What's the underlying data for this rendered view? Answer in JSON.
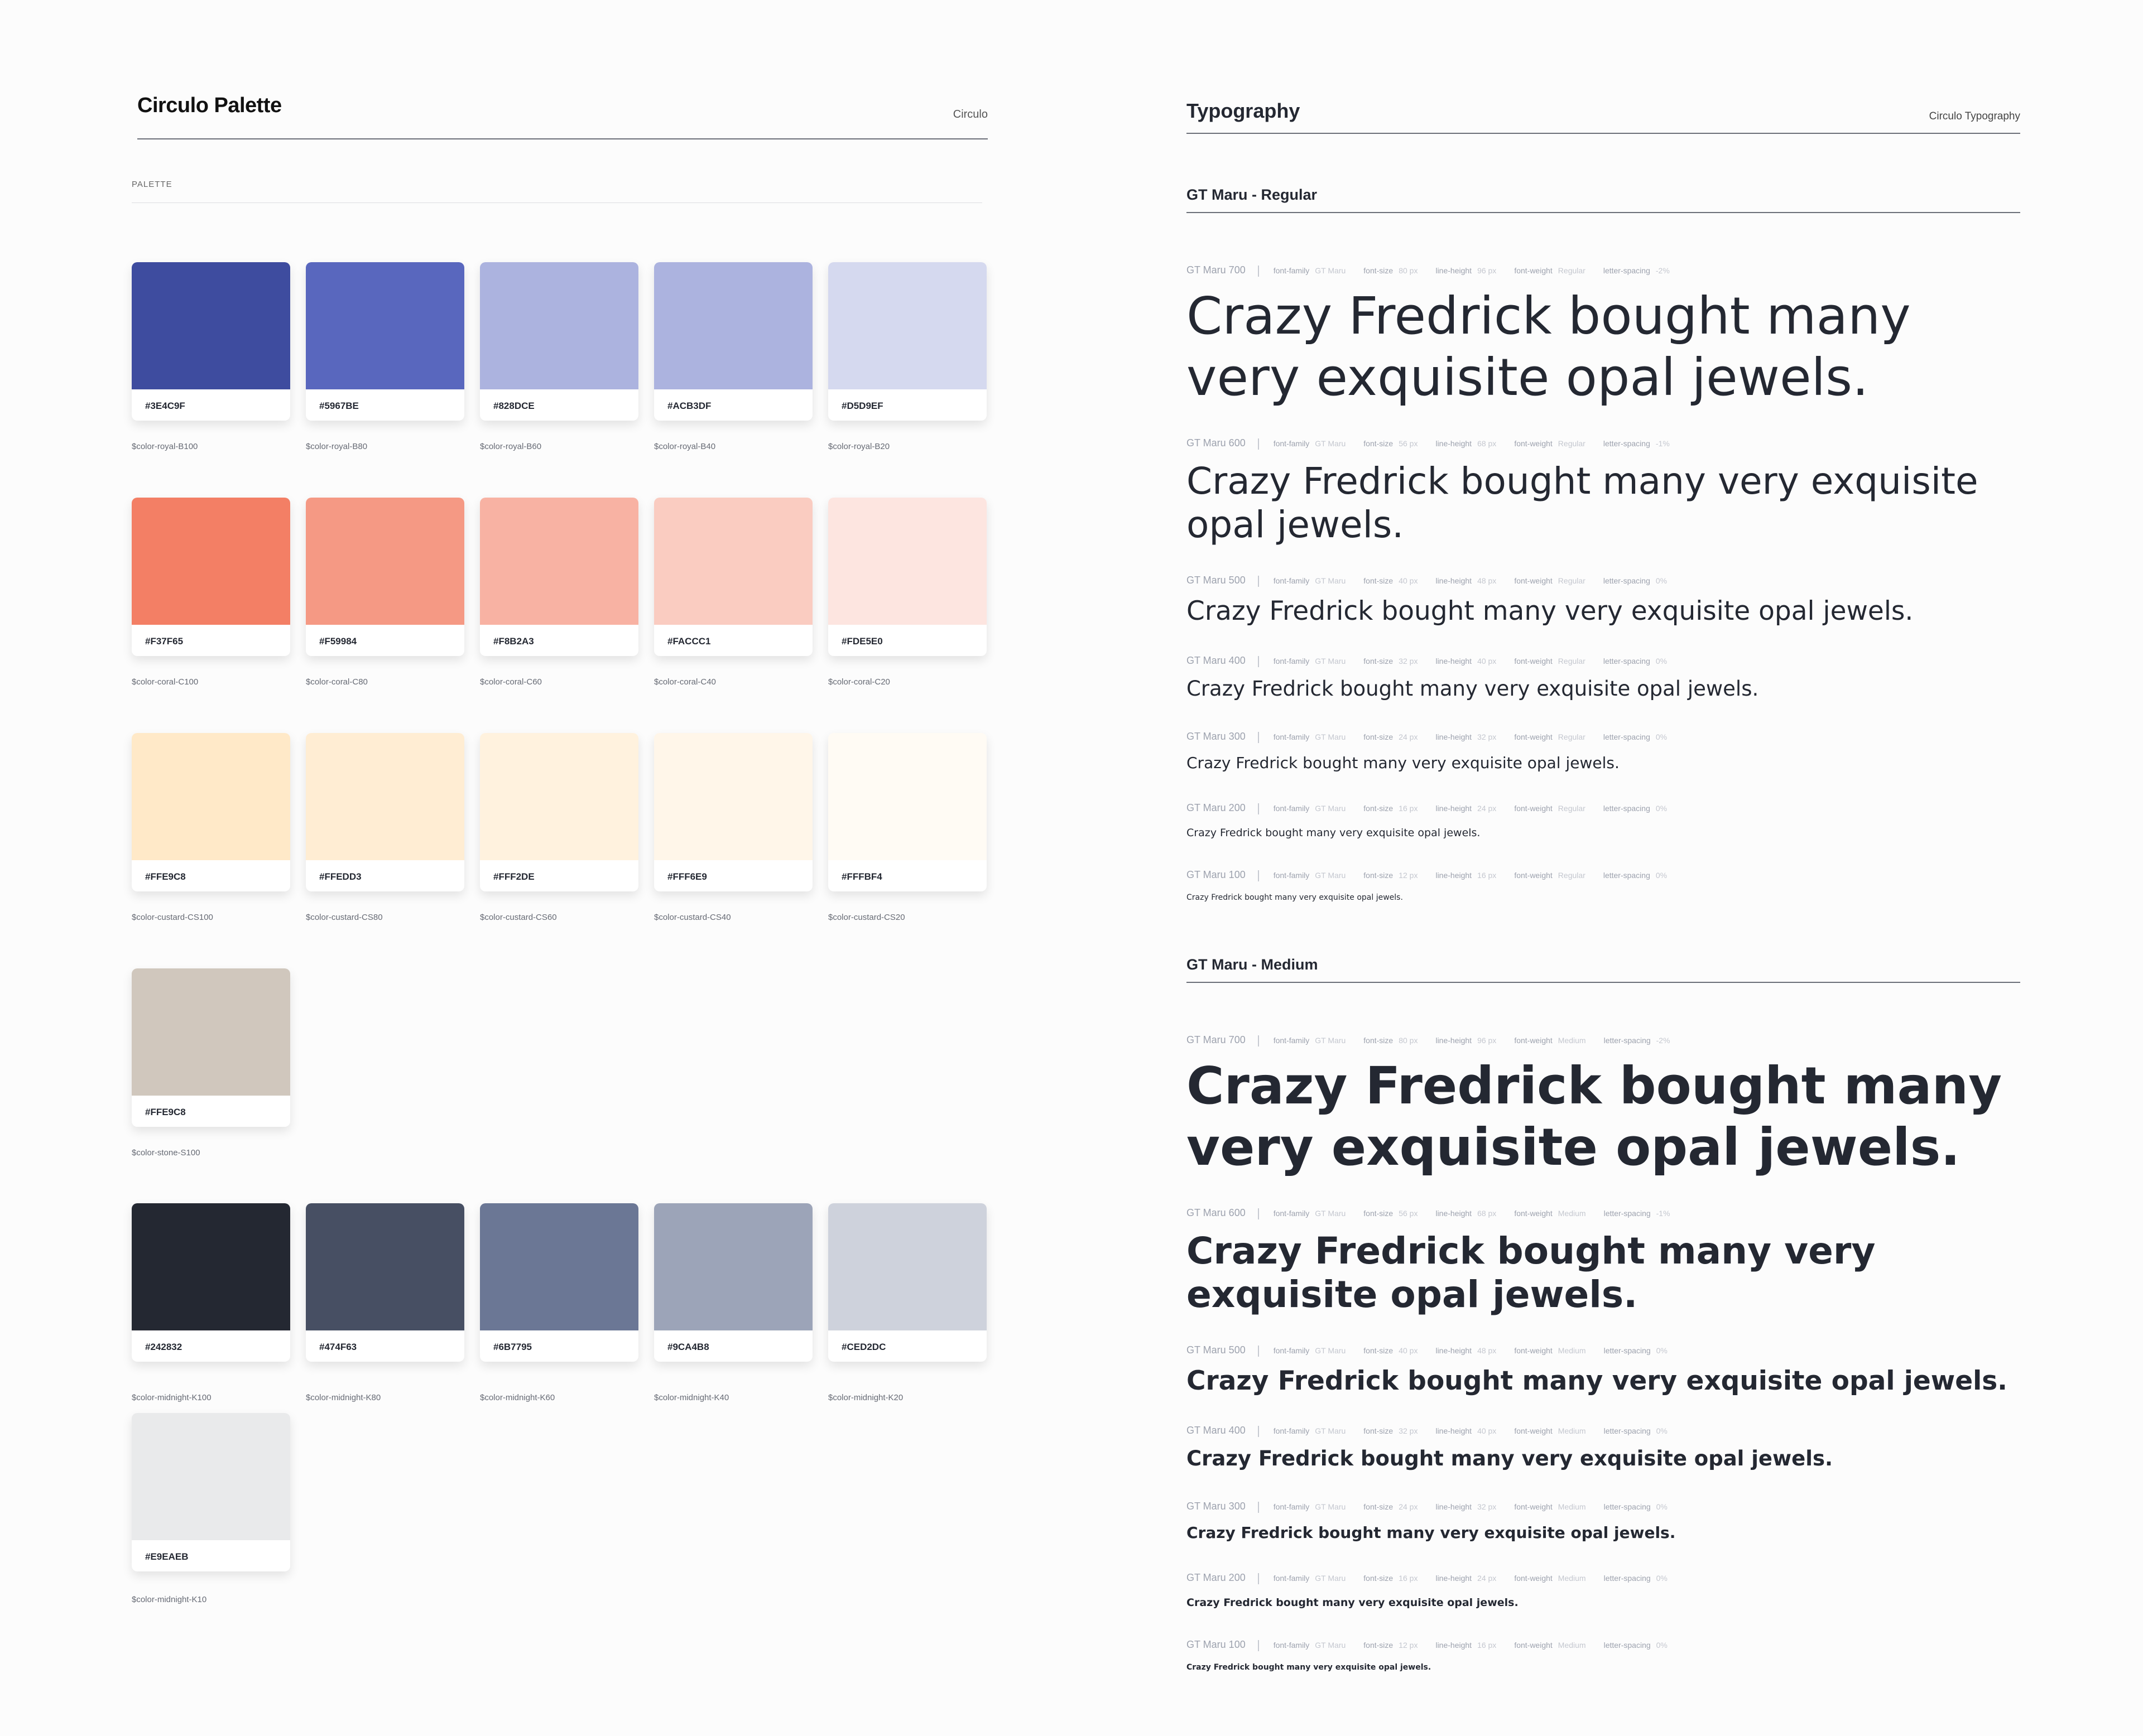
{
  "palette": {
    "title": "Circulo Palette",
    "brand": "Circulo",
    "section_label": "PALETTE",
    "swatches": [
      {
        "hex": "#3E4C9F",
        "token": "$color-royal-B100",
        "color": "#3E4C9F"
      },
      {
        "hex": "#5967BE",
        "token": "$color-royal-B80",
        "color": "#5967BE"
      },
      {
        "hex": "#828DCE",
        "token": "$color-royal-B60",
        "color": "#ACB3DF"
      },
      {
        "hex": "#ACB3DF",
        "token": "$color-royal-B40",
        "color": "#ACB3DF"
      },
      {
        "hex": "#D5D9EF",
        "token": "$color-royal-B20",
        "color": "#D5D9EF"
      },
      {
        "hex": "#F37F65",
        "token": "$color-coral-C100",
        "color": "#F37F65"
      },
      {
        "hex": "#F59984",
        "token": "$color-coral-C80",
        "color": "#F59984"
      },
      {
        "hex": "#F8B2A3",
        "token": "$color-coral-C60",
        "color": "#F8B2A3"
      },
      {
        "hex": "#FACCC1",
        "token": "$color-coral-C40",
        "color": "#FACCC1"
      },
      {
        "hex": "#FDE5E0",
        "token": "$color-coral-C20",
        "color": "#FDE5E0"
      },
      {
        "hex": "#FFE9C8",
        "token": "$color-custard-CS100",
        "color": "#FFE9C8"
      },
      {
        "hex": "#FFEDD3",
        "token": "$color-custard-CS80",
        "color": "#FFEDD3"
      },
      {
        "hex": "#FFF2DE",
        "token": "$color-custard-CS60",
        "color": "#FFF2DE"
      },
      {
        "hex": "#FFF6E9",
        "token": "$color-custard-CS40",
        "color": "#FFF6E9"
      },
      {
        "hex": "#FFFBF4",
        "token": "$color-custard-CS20",
        "color": "#FFFBF4"
      },
      {
        "hex": "#FFE9C8",
        "token": "$color-stone-S100",
        "color": "#D0C7BD"
      },
      {
        "hex": "#242832",
        "token": "$color-midnight-K100",
        "color": "#242832"
      },
      {
        "hex": "#474F63",
        "token": "$color-midnight-K80",
        "color": "#474F63"
      },
      {
        "hex": "#6B7795",
        "token": "$color-midnight-K60",
        "color": "#6B7795"
      },
      {
        "hex": "#9CA4B8",
        "token": "$color-midnight-K40",
        "color": "#9CA4B8"
      },
      {
        "hex": "#CED2DC",
        "token": "$color-midnight-K20",
        "color": "#CED2DC"
      },
      {
        "hex": "#E9EAEB",
        "token": "$color-midnight-K10",
        "color": "#E9EAEB"
      }
    ]
  },
  "typography": {
    "title": "Typography",
    "brand": "Circulo Typography",
    "sample_text": "Crazy Fredrick bought many very exquisite opal jewels.",
    "labels": {
      "family": "font-family",
      "size": "font-size",
      "line_height": "line-height",
      "weight": "font-weight",
      "spacing": "letter-spacing"
    },
    "groups": [
      {
        "heading": "GT Maru - Regular",
        "weight": "Regular",
        "styles": [
          {
            "name": "GT Maru 700",
            "family": "GT Maru",
            "size": "80 px",
            "line_height": "96 px",
            "spacing": "-2%"
          },
          {
            "name": "GT Maru 600",
            "family": "GT Maru",
            "size": "56 px",
            "line_height": "68 px",
            "spacing": "-1%"
          },
          {
            "name": "GT Maru 500",
            "family": "GT Maru",
            "size": "40 px",
            "line_height": "48 px",
            "spacing": "0%"
          },
          {
            "name": "GT Maru 400",
            "family": "GT Maru",
            "size": "32 px",
            "line_height": "40 px",
            "spacing": "0%"
          },
          {
            "name": "GT Maru 300",
            "family": "GT Maru",
            "size": "24 px",
            "line_height": "32 px",
            "spacing": "0%"
          },
          {
            "name": "GT Maru 200",
            "family": "GT Maru",
            "size": "16 px",
            "line_height": "24 px",
            "spacing": "0%"
          },
          {
            "name": "GT Maru 100",
            "family": "GT Maru",
            "size": "12 px",
            "line_height": "16 px",
            "spacing": "0%"
          }
        ]
      },
      {
        "heading": "GT Maru - Medium",
        "weight": "Medium",
        "styles": [
          {
            "name": "GT Maru 700",
            "family": "GT Maru",
            "size": "80 px",
            "line_height": "96 px",
            "spacing": "-2%"
          },
          {
            "name": "GT Maru 600",
            "family": "GT Maru",
            "size": "56 px",
            "line_height": "68 px",
            "spacing": "-1%"
          },
          {
            "name": "GT Maru 500",
            "family": "GT Maru",
            "size": "40 px",
            "line_height": "48 px",
            "spacing": "0%"
          },
          {
            "name": "GT Maru 400",
            "family": "GT Maru",
            "size": "32 px",
            "line_height": "40 px",
            "spacing": "0%"
          },
          {
            "name": "GT Maru 300",
            "family": "GT Maru",
            "size": "24 px",
            "line_height": "32 px",
            "spacing": "0%"
          },
          {
            "name": "GT Maru 200",
            "family": "GT Maru",
            "size": "16 px",
            "line_height": "24 px",
            "spacing": "0%"
          },
          {
            "name": "GT Maru 100",
            "family": "GT Maru",
            "size": "12 px",
            "line_height": "16 px",
            "spacing": "0%"
          }
        ]
      }
    ]
  }
}
